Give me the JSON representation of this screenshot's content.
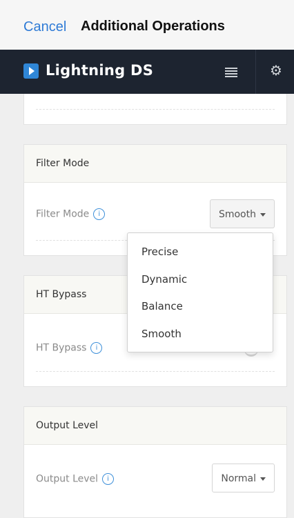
{
  "topbar": {
    "cancel_label": "Cancel",
    "title": "Additional Operations"
  },
  "appbar": {
    "app_name": "Lightning DS",
    "menu_icon": "menu-icon",
    "settings_icon": "gear-icon",
    "logo_icon": "play-logo-icon"
  },
  "sections": {
    "filter_mode": {
      "header": "Filter Mode",
      "label": "Filter Mode",
      "selected": "Smooth",
      "options": [
        "Precise",
        "Dynamic",
        "Balance",
        "Smooth"
      ]
    },
    "ht_bypass": {
      "header": "HT Bypass",
      "label": "HT Bypass"
    },
    "output_level": {
      "header": "Output Level",
      "label": "Output Level",
      "selected": "Normal"
    }
  },
  "info_glyph": "i",
  "colors": {
    "link": "#2f7bd6",
    "appbar_bg": "#1d2430",
    "info": "#3d8fd9"
  }
}
